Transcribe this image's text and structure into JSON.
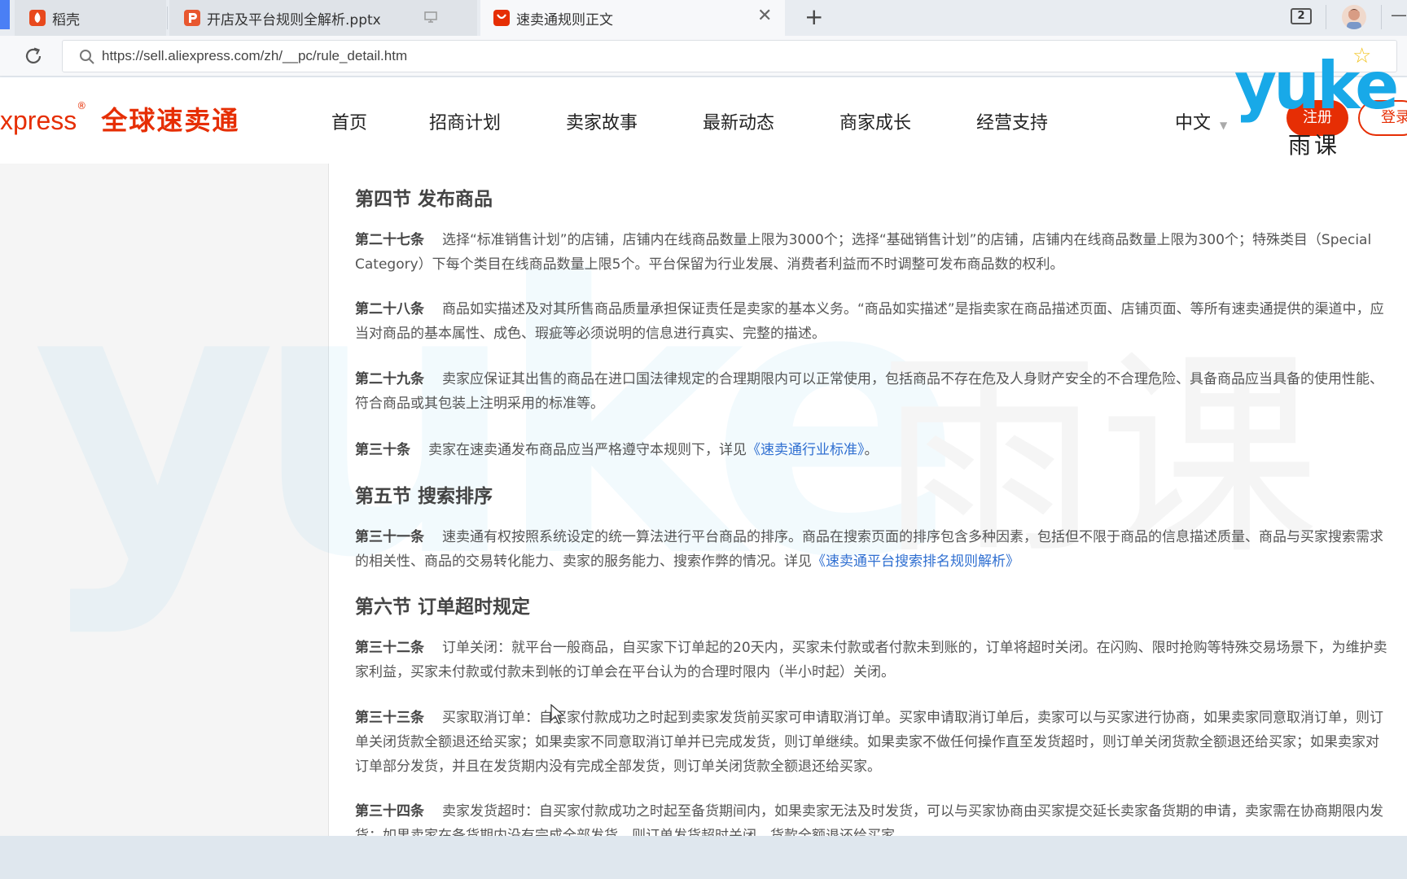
{
  "browser": {
    "tabs": [
      {
        "title": "稻壳",
        "icon": "docer-icon"
      },
      {
        "title": "开店及平台规则全解析.pptx",
        "icon": "wps-presentation-icon"
      },
      {
        "title": "速卖通规则正文",
        "icon": "aliexpress-icon"
      }
    ],
    "window_count": "2",
    "url": "https://sell.aliexpress.com/zh/__pc/rule_detail.htm"
  },
  "site": {
    "logo_en": "xpress",
    "logo_cn": "全球速卖通",
    "nav": [
      "首页",
      "招商计划",
      "卖家故事",
      "最新动态",
      "商家成长",
      "经营支持"
    ],
    "language": "中文",
    "register": "注册",
    "login": "登录"
  },
  "watermark": {
    "brand": "yuke",
    "brand_cn": "雨课"
  },
  "article": {
    "s4": {
      "title": "第四节 发布商品"
    },
    "r27": {
      "head": "第二十七条",
      "text": "选择“标准销售计划”的店铺，店铺内在线商品数量上限为3000个；选择“基础销售计划”的店铺，店铺内在线商品数量上限为300个；特殊类目（Special Category）下每个类目在线商品数量上限5个。平台保留为行业发展、消费者利益而不时调整可发布商品数的权利。"
    },
    "r28": {
      "head": "第二十八条",
      "text": "商品如实描述及对其所售商品质量承担保证责任是卖家的基本义务。“商品如实描述”是指卖家在商品描述页面、店铺页面、等所有速卖通提供的渠道中，应当对商品的基本属性、成色、瑕疵等必须说明的信息进行真实、完整的描述。"
    },
    "r29": {
      "head": "第二十九条",
      "text": "卖家应保证其出售的商品在进口国法律规定的合理期限内可以正常使用，包括商品不存在危及人身财产安全的不合理危险、具备商品应当具备的使用性能、符合商品或其包装上注明采用的标准等。"
    },
    "r30": {
      "head": "第三十条",
      "text": "卖家在速卖通发布商品应当严格遵守本规则下，详见",
      "link": "《速卖通行业标准》",
      "tail": "。"
    },
    "s5": {
      "title": "第五节 搜索排序"
    },
    "r31": {
      "head": "第三十一条",
      "text": "速卖通有权按照系统设定的统一算法进行平台商品的排序。商品在搜索页面的排序包含多种因素，包括但不限于商品的信息描述质量、商品与买家搜索需求的相关性、商品的交易转化能力、卖家的服务能力、搜索作弊的情况。详见",
      "link": "《速卖通平台搜索排名规则解析》"
    },
    "s6": {
      "title": "第六节 订单超时规定"
    },
    "r32": {
      "head": "第三十二条",
      "text": "订单关闭：就平台一般商品，自买家下订单起的20天内，买家未付款或者付款未到账的，订单将超时关闭。在闪购、限时抢购等特殊交易场景下，为维护卖家利益，买家未付款或付款未到帐的订单会在平台认为的合理时限内（半小时起）关闭。"
    },
    "r33": {
      "head": "第三十三条",
      "text": "买家取消订单：自买家付款成功之时起到卖家发货前买家可申请取消订单。买家申请取消订单后，卖家可以与买家进行协商，如果卖家同意取消订单，则订单关闭货款全额退还给买家；如果卖家不同意取消订单并已完成发货，则订单继续。如果卖家不做任何操作直至发货超时，则订单关闭货款全额退还给买家；如果卖家对订单部分发货，并且在发货期内没有完成全部发货，则订单关闭货款全额退还给买家。"
    },
    "r34": {
      "head": "第三十四条",
      "text": "卖家发货超时：自买家付款成功之时起至备货期间内，如果卖家无法及时发货，可以与买家协商由买家提交延长卖家备货期的申请，卖家需在协商期限内发货；如果卖家在备货期内没有完成全部发货，则订单发货超时关闭，货款全额退还给买家。"
    }
  }
}
